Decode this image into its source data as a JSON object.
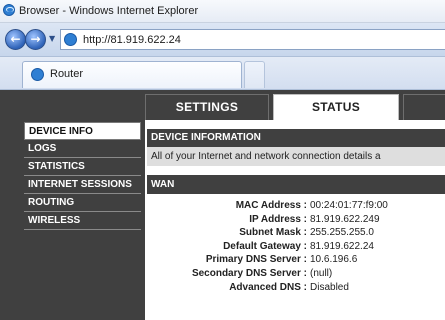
{
  "window": {
    "title": "Browser - Windows Internet Explorer",
    "icon": "internet-explorer-icon"
  },
  "navigation": {
    "back_icon": "back-arrow-icon",
    "forward_icon": "forward-arrow-icon",
    "back_glyph": "←",
    "forward_glyph": "→",
    "dropdown_glyph": "▼",
    "address": "http://81.919.622.24"
  },
  "tabs": [
    {
      "label": "Router"
    }
  ],
  "router": {
    "top_tabs": [
      {
        "label": "SETTINGS"
      },
      {
        "label": "STATUS"
      }
    ],
    "sidebar": [
      {
        "label": "DEVICE INFO"
      },
      {
        "label": "LOGS"
      },
      {
        "label": "STATISTICS"
      },
      {
        "label": "INTERNET SESSIONS"
      },
      {
        "label": "ROUTING"
      },
      {
        "label": "WIRELESS"
      }
    ],
    "device_info": {
      "heading": "DEVICE INFORMATION",
      "description": "All of your Internet and network connection details a"
    },
    "wan": {
      "heading": "WAN",
      "rows": [
        {
          "label": "MAC Address :",
          "value": "00:24:01:77:f9:00"
        },
        {
          "label": "IP Address :",
          "value": "81.919.622.249"
        },
        {
          "label": "Subnet Mask :",
          "value": "255.255.255.0"
        },
        {
          "label": "Default Gateway :",
          "value": "81.919.622.24"
        },
        {
          "label": "Primary DNS Server :",
          "value": "10.6.196.6"
        },
        {
          "label": "Secondary DNS Server :",
          "value": "(null)"
        },
        {
          "label": "Advanced DNS :",
          "value": "Disabled"
        }
      ]
    }
  },
  "colors": {
    "router_dark": "#404040",
    "ie_blue": "#2f7fd3"
  }
}
